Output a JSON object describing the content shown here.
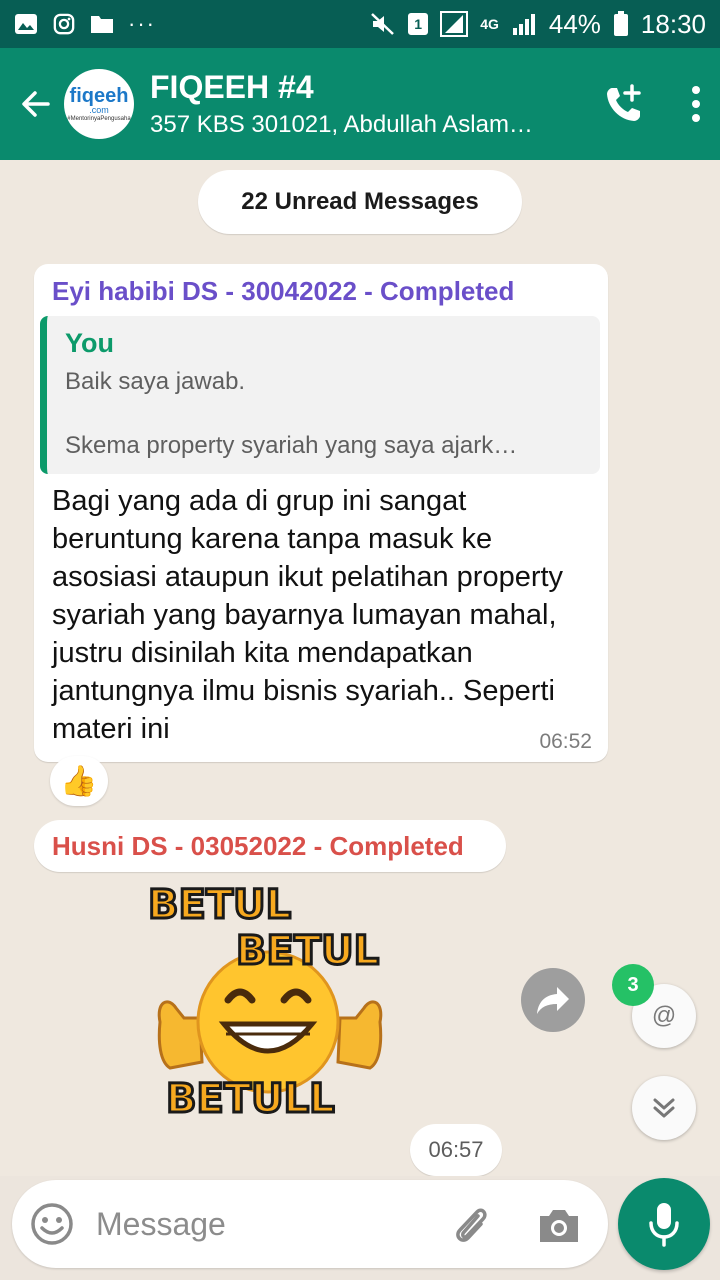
{
  "status_bar": {
    "battery": "44%",
    "time": "18:30",
    "sim_badge": "1",
    "network": "4G"
  },
  "header": {
    "title": "FIQEEH #4",
    "subtitle": "357 KBS 301021, Abdullah Aslam…",
    "avatar_logo": "fiqeeh",
    "avatar_logo_suffix": ".com",
    "avatar_tagline": "#MentorinyaPengusaha"
  },
  "chat": {
    "unread_banner": "22 Unread Messages",
    "message1": {
      "sender": "Eyi habibi DS - 30042022 - Completed",
      "quote_author": "You",
      "quote_line1": "Baik saya jawab.",
      "quote_line2": "Skema property syariah yang saya ajark…",
      "body": "Bagi yang ada di grup ini sangat beruntung karena tanpa masuk ke asosiasi ataupun ikut pelatihan property syariah yang bayarnya lumayan mahal, justru disinilah kita mendapatkan jantungnya ilmu bisnis syariah.. Seperti materi ini",
      "time": "06:52",
      "reaction": "👍"
    },
    "message2": {
      "sender": "Husni DS - 03052022 - Completed",
      "sticker_words": [
        "BETUL",
        "BETUL",
        "BETULL"
      ],
      "time": "06:57"
    },
    "mention_badge": "3",
    "mention_symbol": "@"
  },
  "input": {
    "placeholder": "Message"
  },
  "colors": {
    "header": "#0a8a6d",
    "status": "#075e54",
    "accent_green": "#25c166",
    "sender1": "#6a4fc9",
    "sender2": "#d9504a"
  }
}
